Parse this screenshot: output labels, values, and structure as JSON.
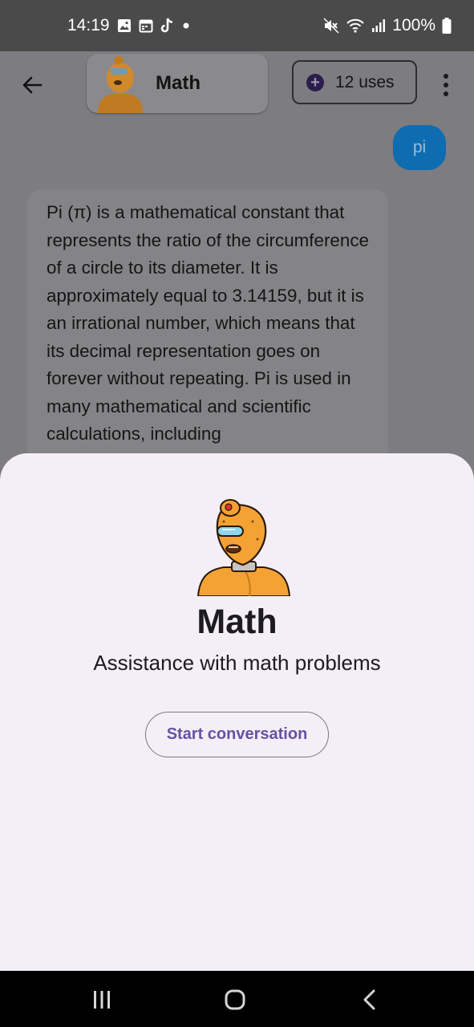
{
  "status_bar": {
    "time": "14:19",
    "battery": "100%",
    "left_icons": [
      "gallery-icon",
      "calendar-icon",
      "tiktok-icon",
      "dot-icon"
    ],
    "right_icons": [
      "mute-icon",
      "wifi-icon",
      "signal-icon",
      "battery-icon"
    ]
  },
  "header": {
    "assistant_name": "Math",
    "uses_label": "12 uses"
  },
  "chat": {
    "user_message": "pi",
    "assistant_message": "Pi (π) is a mathematical constant that represents the ratio of the circumference of a circle to its diameter. It is approximately equal to 3.14159, but it is an irrational number, which means that its decimal representation goes on forever without repeating. Pi is used in many mathematical and scientific calculations, including"
  },
  "sheet": {
    "title": "Math",
    "description": "Assistance with math problems",
    "start_button": "Start conversation"
  },
  "colors": {
    "accent": "#6750a4",
    "user_bubble": "#0e6cb0",
    "sheet_bg": "#f4eff7",
    "robot_orange": "#f5a235"
  }
}
